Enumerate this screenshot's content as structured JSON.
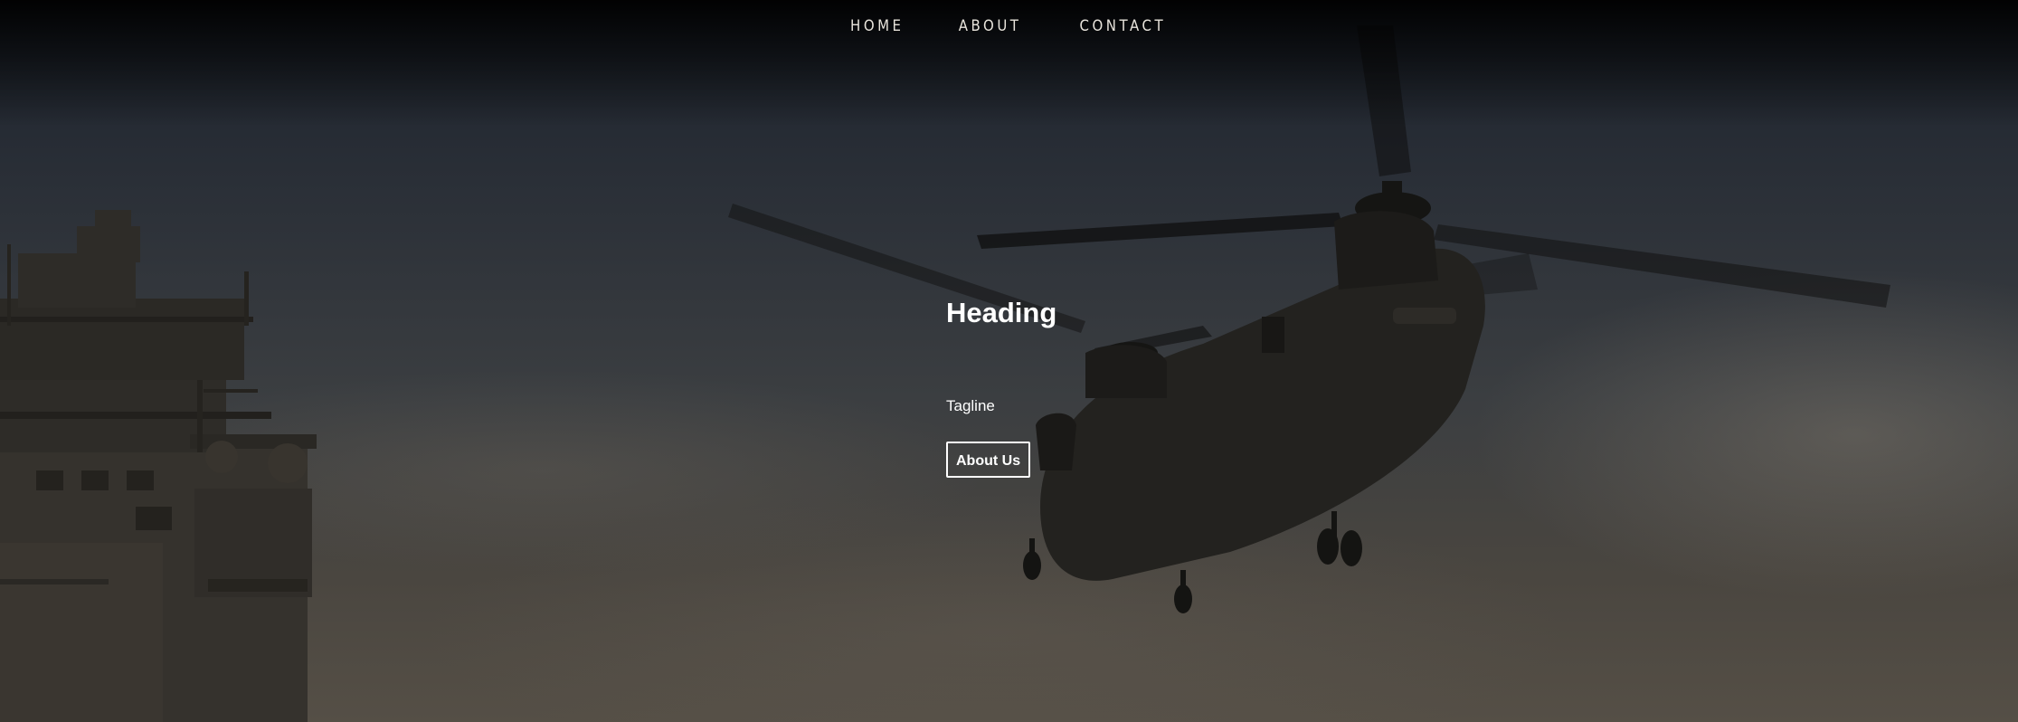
{
  "nav": {
    "items": [
      {
        "label": "HOME"
      },
      {
        "label": "ABOUT"
      },
      {
        "label": "CONTACT"
      }
    ]
  },
  "hero": {
    "heading": "Heading",
    "tagline": "Tagline",
    "button_label": "About Us",
    "background_image": "helicopter-over-ship-photo"
  },
  "colors": {
    "text": "#ffffff",
    "nav_text": "#e8e4dc",
    "overlay": "#000000"
  }
}
